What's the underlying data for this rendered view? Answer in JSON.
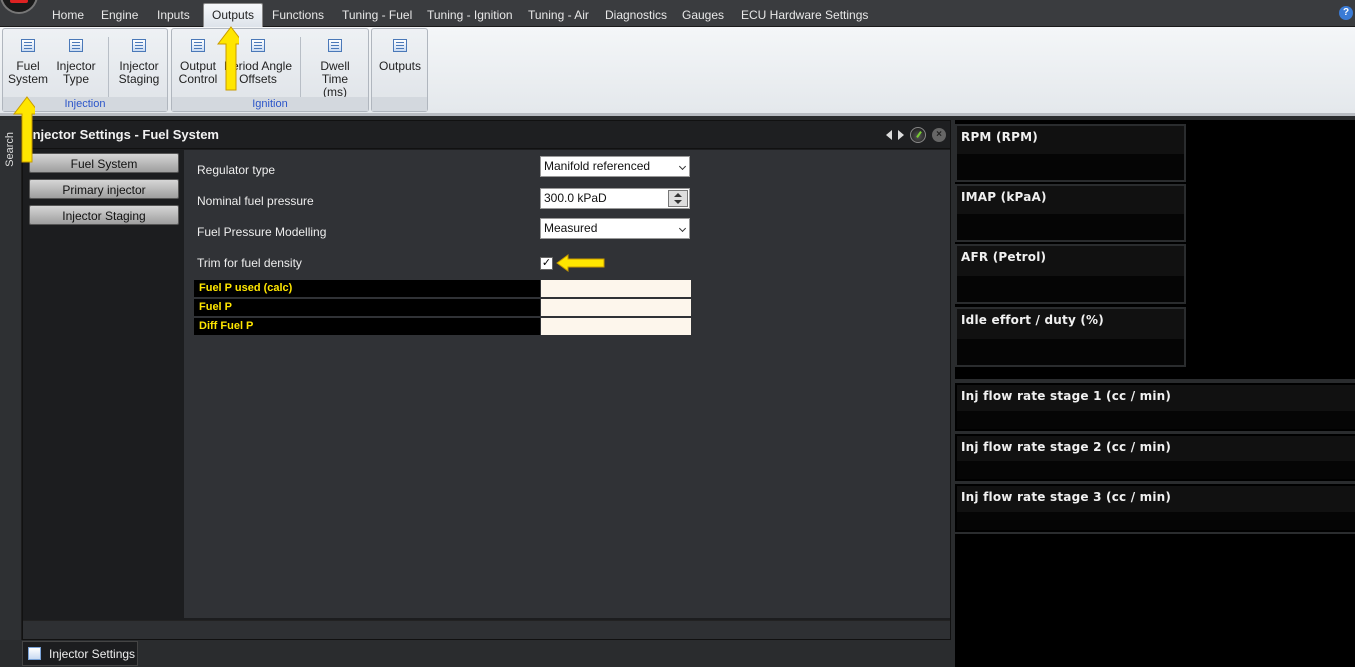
{
  "menu": {
    "items": [
      "Home",
      "Engine",
      "Inputs",
      "Outputs",
      "Functions",
      "Tuning - Fuel",
      "Tuning - Ignition",
      "Tuning - Air",
      "Diagnostics",
      "Gauges",
      "ECU Hardware Settings"
    ],
    "active": "Outputs",
    "help_label": "?"
  },
  "ribbon": {
    "groups": [
      {
        "label": "Injection",
        "buttons": [
          "Fuel\nSystem",
          "Injector\nType",
          "Injector\nStaging"
        ]
      },
      {
        "label": "Ignition",
        "buttons": [
          "Output\nControl",
          "Period Angle\nOffsets",
          "Dwell Time\n(ms)"
        ]
      },
      {
        "label": "",
        "buttons": [
          "Outputs"
        ]
      }
    ]
  },
  "search_tab": {
    "label": "Search"
  },
  "panel": {
    "title": "Injector Settings - Fuel System",
    "nav": [
      "Fuel System",
      "Primary injector",
      "Injector Staging"
    ],
    "form": {
      "regulator_type_label": "Regulator type",
      "regulator_type_value": "Manifold referenced",
      "nominal_pressure_label": "Nominal fuel pressure",
      "nominal_pressure_value": "300.0 kPaD",
      "pressure_modelling_label": "Fuel Pressure Modelling",
      "pressure_modelling_value": "Measured",
      "trim_density_label": "Trim for fuel density",
      "trim_density_checked": true,
      "check_mark": "✓"
    },
    "data_rows": [
      {
        "label": "Fuel P used (calc)",
        "value": ""
      },
      {
        "label": "Fuel P",
        "value": ""
      },
      {
        "label": "Diff Fuel P",
        "value": ""
      }
    ],
    "close_glyph": "×"
  },
  "gauges": [
    "RPM (RPM)",
    "IMAP  (kPaA)",
    "AFR (Petrol)",
    "Idle effort / duty (%)",
    "Inj flow rate stage 1 (cc / min)",
    "Inj flow rate stage 2 (cc / min)",
    "Inj flow rate stage 3 (cc / min)"
  ],
  "status_tab": {
    "label": "Injector Settings"
  },
  "colors": {
    "annotation_arrow": "#ffe600",
    "group_label": "#2b55c9",
    "data_label": "#ffe600"
  }
}
